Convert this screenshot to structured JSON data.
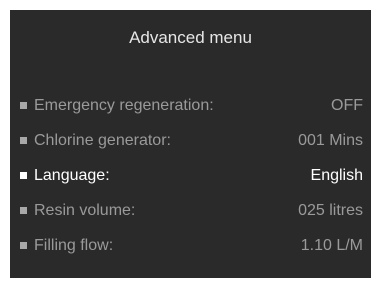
{
  "screen": {
    "title": "Advanced menu",
    "items": [
      {
        "label": "Emergency regeneration:",
        "value": "OFF",
        "selected": false
      },
      {
        "label": "Chlorine generator:",
        "value": "001 Mins",
        "selected": false
      },
      {
        "label": "Language:",
        "value": "English",
        "selected": true
      },
      {
        "label": "Resin volume:",
        "value": "025 litres",
        "selected": false
      },
      {
        "label": "Filling flow:",
        "value": "1.10 L/M",
        "selected": false
      }
    ]
  },
  "colors": {
    "background": "#2a2a2a",
    "text_dim": "#9a9a9a",
    "text_selected": "#ffffff"
  }
}
